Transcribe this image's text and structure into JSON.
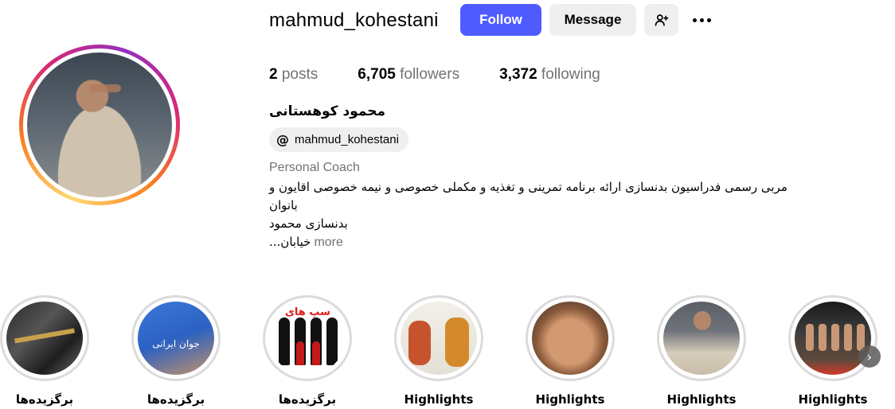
{
  "profile": {
    "username": "mahmud_kohestani",
    "full_name": "محمود کوهستانی",
    "threads_handle": "mahmud_kohestani",
    "category": "Personal Coach",
    "bio_lines": [
      "مربی رسمی فدراسیون بدنسازی ارائه برنامه تمرینی و تغذیه و مکملی خصوصی و نیمه خصوصی اقایون و",
      "بانوان",
      "بدنسازی محمود",
      "خیابان..."
    ],
    "more_label": "more"
  },
  "actions": {
    "follow_label": "Follow",
    "message_label": "Message",
    "add_user_icon": "person-plus-icon",
    "more_icon": "more-horizontal-icon"
  },
  "stats": {
    "posts_count": "2",
    "posts_label": "posts",
    "followers_count": "6,705",
    "followers_label": "followers",
    "following_count": "3,372",
    "following_label": "following"
  },
  "highlights": [
    {
      "label": "برگزیده‌ها"
    },
    {
      "label": "برگزیده‌ها",
      "image_text": "جوان ایرانی"
    },
    {
      "label": "برگزیده‌ها",
      "image_text": "سپ های"
    },
    {
      "label": "Highlights"
    },
    {
      "label": "Highlights"
    },
    {
      "label": "Highlights"
    },
    {
      "label": "Highlights"
    }
  ],
  "colors": {
    "follow_button": "#4f5bff",
    "secondary_button": "#efefef",
    "muted_text": "#737373"
  }
}
